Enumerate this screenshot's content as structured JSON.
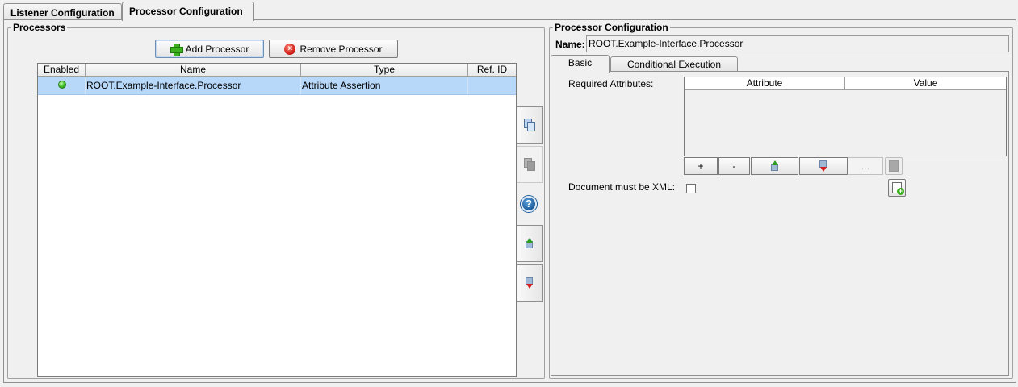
{
  "tabs": {
    "listener": "Listener Configuration",
    "processor": "Processor Configuration"
  },
  "processors_panel": {
    "title": "Processors",
    "add_button": "Add Processor",
    "remove_button": "Remove Processor",
    "columns": [
      "Enabled",
      "Name",
      "Type",
      "Ref. ID"
    ],
    "rows": [
      {
        "enabled": true,
        "name": "ROOT.Example-Interface.Processor",
        "type": "Attribute Assertion",
        "ref_id": ""
      }
    ]
  },
  "config_panel": {
    "title": "Processor Configuration",
    "name_label": "Name:",
    "name_value": "ROOT.Example-Interface.Processor",
    "tabs": [
      "Basic",
      "Conditional Execution"
    ],
    "required_attributes_label": "Required Attributes:",
    "attr_columns": [
      "Attribute",
      "Value"
    ],
    "attr_buttons": {
      "add": "+",
      "remove": "-",
      "more": "..."
    },
    "xml_label": "Document must be XML:",
    "xml_checked": false
  },
  "colors": {
    "selection": "#b8d8f9",
    "background": "#f0f0f0"
  }
}
